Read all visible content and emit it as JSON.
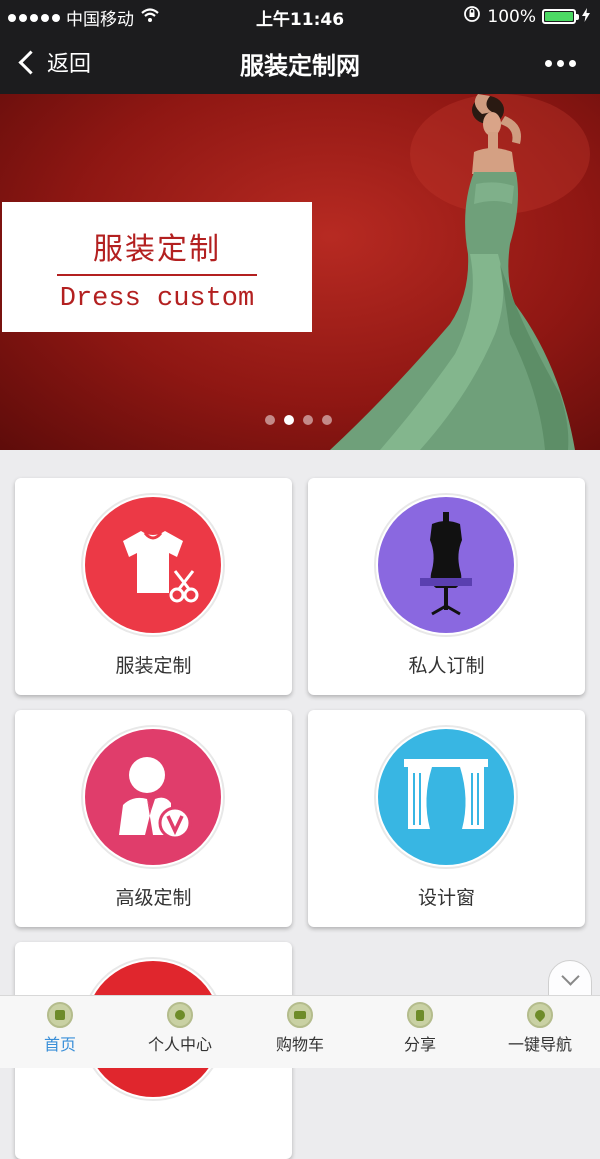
{
  "status_bar": {
    "carrier": "中国移动",
    "time": "上午11:46",
    "battery": "100%",
    "battery_level": 1.0,
    "signal_icon": "signal-dots-icon",
    "wifi_icon": "wifi-icon",
    "rotation_lock_icon": "rotation-lock-icon",
    "charging_icon": "charging-bolt-icon"
  },
  "navbar": {
    "back_label": "返回",
    "title": "服装定制网",
    "more_icon": "more-dots-icon"
  },
  "banner": {
    "title_cn": "服装定制",
    "title_en": "Dress custom",
    "slide_count": 4,
    "active_slide": 2,
    "background_color": "#9a1a15"
  },
  "grid": {
    "tiles": [
      {
        "label": "服装定制",
        "icon": "tshirt-scissors-icon",
        "color": "#ec3946"
      },
      {
        "label": "私人订制",
        "icon": "dress-form-icon",
        "color": "#8a68e0"
      },
      {
        "label": "高级定制",
        "icon": "vip-user-icon",
        "color": "#e03d6b"
      },
      {
        "label": "设计窗",
        "icon": "curtain-window-icon",
        "color": "#38b6e3"
      },
      {
        "label": "",
        "icon": "play-icon",
        "color": "#e0262d"
      }
    ]
  },
  "tabbar": {
    "items": [
      {
        "label": "首页",
        "icon": "home-icon",
        "active": true
      },
      {
        "label": "个人中心",
        "icon": "user-icon",
        "active": false
      },
      {
        "label": "购物车",
        "icon": "cart-icon",
        "active": false
      },
      {
        "label": "分享",
        "icon": "share-icon",
        "active": false
      },
      {
        "label": "一键导航",
        "icon": "location-icon",
        "active": false
      }
    ],
    "active_color": "#3a8fd8"
  },
  "scroll_button_icon": "chevron-down-icon"
}
